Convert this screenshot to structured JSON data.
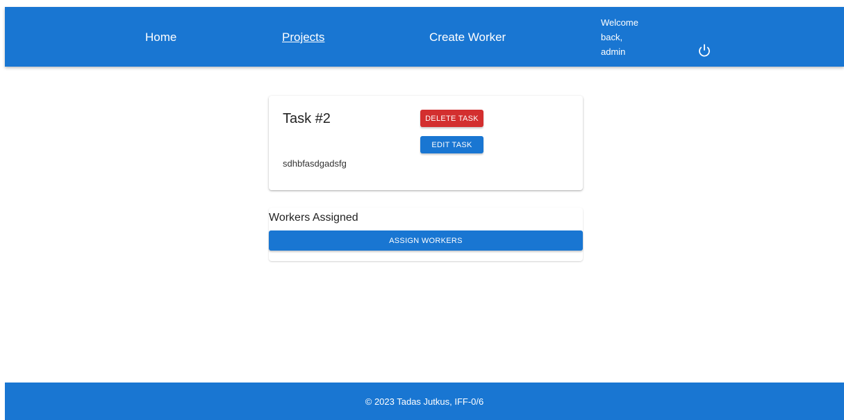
{
  "nav": {
    "home": "Home",
    "projects": "Projects",
    "create_worker": "Create Worker",
    "welcome_line1": "Welcome",
    "welcome_line2": "back,",
    "welcome_line3": "admin",
    "logout_icon": "power-icon"
  },
  "task": {
    "title": "Task #2",
    "description": "sdhbfasdgadsfg",
    "delete_label": "DELETE TASK",
    "edit_label": "EDIT TASK"
  },
  "workers": {
    "title": "Workers Assigned",
    "assign_label": "ASSIGN WORKERS"
  },
  "footer": {
    "text": "© 2023 Tadas Jutkus, IFF-0/6"
  },
  "colors": {
    "primary": "#1976d2",
    "danger": "#d32f2f"
  }
}
